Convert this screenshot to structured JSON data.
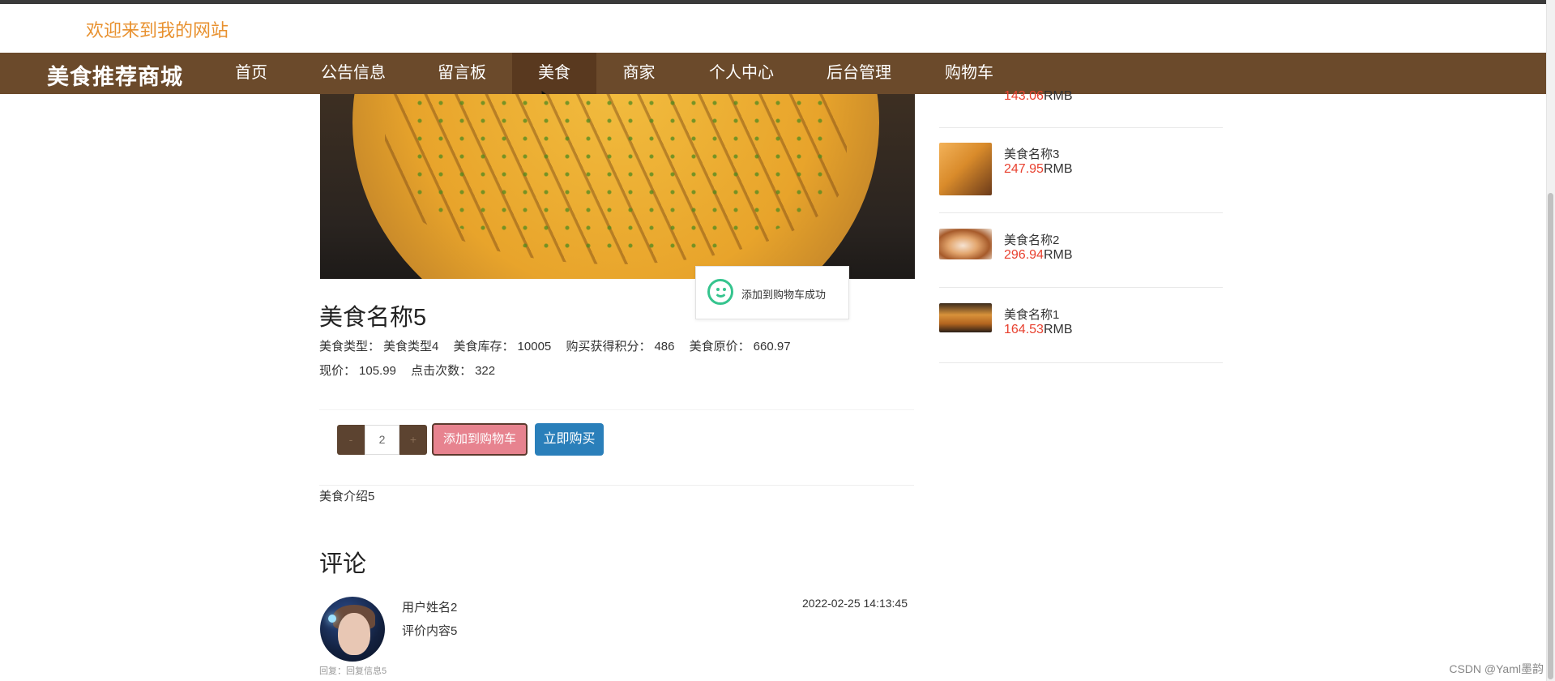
{
  "header": {
    "welcome_text": "欢迎来到我的网站"
  },
  "nav": {
    "brand": "美食推荐商城",
    "items": [
      {
        "label": "首页"
      },
      {
        "label": "公告信息"
      },
      {
        "label": "留言板"
      },
      {
        "label": "美食",
        "active": true
      },
      {
        "label": "商家"
      },
      {
        "label": "个人中心"
      },
      {
        "label": "后台管理"
      },
      {
        "label": "购物车"
      }
    ]
  },
  "toast": {
    "icon": "smile-icon",
    "message": "添加到购物车成功"
  },
  "product": {
    "name": "美食名称5",
    "type_label": "美食类型：",
    "type_value": "美食类型4",
    "stock_label": "美食库存：",
    "stock_value": "10005",
    "points_label": "购买获得积分：",
    "points_value": "486",
    "orig_price_label": "美食原价：",
    "orig_price_value": "660.97",
    "price_label": "现价：",
    "price_value": "105.99",
    "clicks_label": "点击次数：",
    "clicks_value": "322",
    "intro": "美食介绍5"
  },
  "purchase": {
    "minus_label": "-",
    "quantity": "2",
    "plus_label": "+",
    "add_cart_label": "添加到购物车",
    "buy_now_label": "立即购买"
  },
  "comments": {
    "title": "评论",
    "items": [
      {
        "user": "用户姓名2",
        "content": "评价内容5",
        "time": "2022-02-25 14:13:45",
        "reply": "回复：回复信息5"
      }
    ]
  },
  "sidebar": {
    "items": [
      {
        "name": "",
        "price": "143.06",
        "unit": "RMB"
      },
      {
        "name": "美食名称3",
        "price": "247.95",
        "unit": "RMB"
      },
      {
        "name": "美食名称2",
        "price": "296.94",
        "unit": "RMB"
      },
      {
        "name": "美食名称1",
        "price": "164.53",
        "unit": "RMB"
      }
    ]
  },
  "watermark": "CSDN @Yaml墨韵",
  "colors": {
    "nav_bg": "#6b4a2b",
    "welcome": "#e8912f",
    "price_red": "#e8412f",
    "cart_button": "#e7838f",
    "buy_button": "#2a7fba",
    "toast_icon": "#35c48e"
  }
}
